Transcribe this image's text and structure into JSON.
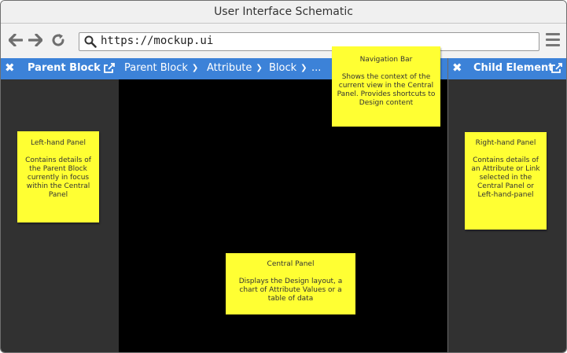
{
  "window": {
    "title": "User Interface Schematic"
  },
  "browser": {
    "url": "https://mockup.ui"
  },
  "left_panel": {
    "header": "Parent Block"
  },
  "right_panel": {
    "header": "Child Element"
  },
  "navigation": {
    "items": [
      {
        "label": "Parent Block"
      },
      {
        "label": "Attribute"
      },
      {
        "label": "Block"
      },
      {
        "label": "..."
      }
    ]
  },
  "notes": {
    "navigation_bar": {
      "title": "Navigation Bar",
      "body": "Shows the context of the current view in the Central Panel.  Provides shortcuts to Design content"
    },
    "left_hand_panel": {
      "title": "Left-hand Panel",
      "body": "Contains details of the Parent Block currently in focus within the Central Panel"
    },
    "right_hand_panel": {
      "title": "Right-hand Panel",
      "body": "Contains details of an Attribute or Link selected in the Central Panel or Left-hand-panel"
    },
    "central_panel": {
      "title": "Central Panel",
      "body": "Displays the Design layout, a chart of Attribute Values or a table of data"
    }
  },
  "colors": {
    "accent": "#3c82d8",
    "panel": "#313131",
    "canvas": "#000000",
    "sticky": "#ffff33"
  },
  "icons": [
    "back-arrow-icon",
    "forward-arrow-icon",
    "refresh-icon",
    "search-icon",
    "hamburger-menu-icon",
    "close-icon",
    "share-icon",
    "chevron-down-icon"
  ]
}
